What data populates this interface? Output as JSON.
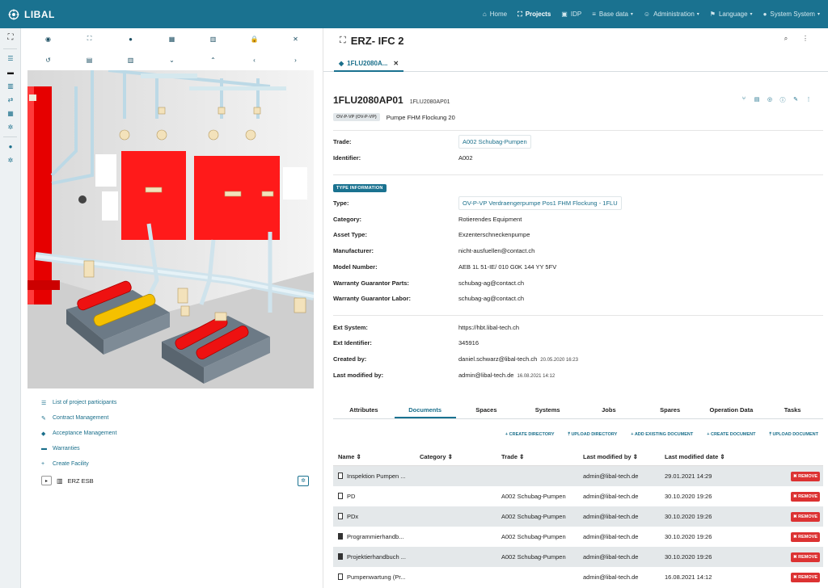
{
  "app": {
    "name": "LIBAL"
  },
  "nav": [
    {
      "icon": "home-icon",
      "glyph": "⌂",
      "label": "Home",
      "caret": false,
      "active": false
    },
    {
      "icon": "projects-icon",
      "glyph": "⛶",
      "label": "Projects",
      "caret": false,
      "active": true
    },
    {
      "icon": "idp-icon",
      "glyph": "▣",
      "label": "IDP",
      "caret": false,
      "active": false
    },
    {
      "icon": "database-icon",
      "glyph": "≡",
      "label": "Base data",
      "caret": true,
      "active": false
    },
    {
      "icon": "user-plus-icon",
      "glyph": "☺",
      "label": "Administration",
      "caret": true,
      "active": false
    },
    {
      "icon": "flag-icon",
      "glyph": "⚑",
      "label": "Language",
      "caret": true,
      "active": false
    },
    {
      "icon": "user-icon",
      "glyph": "●",
      "label": "System System",
      "caret": true,
      "active": false
    }
  ],
  "toolbar": {
    "row1": [
      {
        "icon": "eye-icon",
        "glyph": "◉"
      },
      {
        "icon": "expand-icon",
        "glyph": "⛶"
      },
      {
        "icon": "circle-icon",
        "glyph": "●"
      },
      {
        "icon": "grid-icon",
        "glyph": "▦"
      },
      {
        "icon": "building-icon",
        "glyph": "▥"
      },
      {
        "icon": "lock-icon",
        "glyph": "🔒"
      },
      {
        "icon": "close-icon",
        "glyph": "✕"
      }
    ],
    "row2": [
      {
        "icon": "undo-icon",
        "glyph": "↺"
      },
      {
        "icon": "floor-icon",
        "glyph": "▤"
      },
      {
        "icon": "structure-icon",
        "glyph": "▥"
      },
      {
        "icon": "chevron-down-icon",
        "glyph": "⌄"
      },
      {
        "icon": "chevron-up-icon",
        "glyph": "⌃"
      },
      {
        "icon": "chevron-left-icon",
        "glyph": "‹"
      },
      {
        "icon": "chevron-right-icon",
        "glyph": "›"
      }
    ]
  },
  "facility": {
    "links": [
      {
        "icon": "list-icon",
        "glyph": "☰",
        "label": "List of project participants"
      },
      {
        "icon": "contract-icon",
        "glyph": "✎",
        "label": "Contract Management"
      },
      {
        "icon": "tag-icon",
        "glyph": "◆",
        "label": "Acceptance Management"
      },
      {
        "icon": "truck-icon",
        "glyph": "▬",
        "label": "Warranties"
      },
      {
        "icon": "plus-icon",
        "glyph": "+",
        "label": "Create Facility"
      }
    ],
    "tree_item": "ERZ ESB"
  },
  "project": {
    "title": "ERZ- IFC 2"
  },
  "tab": {
    "label": "1FLU2080A..."
  },
  "asset": {
    "id": "1FLU2080AP01",
    "id_small": "1FLU2080AP01",
    "chip": "OV-P-VP (OV-P-VP)",
    "description": "Pumpe FHM Flockung 20"
  },
  "fields": {
    "trade": {
      "label": "Trade:",
      "value": "A002 Schubag-Pumpen"
    },
    "identifier": {
      "label": "Identifier:",
      "value": "A002"
    },
    "type_badge": "TYPE INFORMATION",
    "type": {
      "label": "Type:",
      "value": "OV-P-VP Verdraengerpumpe Pos1 FHM Flockung - 1FLU"
    },
    "category": {
      "label": "Category:",
      "value": "Rotierendes Equipment"
    },
    "asset_type": {
      "label": "Asset Type:",
      "value": "Exzenterschneckenpumpe"
    },
    "manufacturer": {
      "label": "Manufacturer:",
      "value": "nicht-ausfuellen@contact.ch"
    },
    "model": {
      "label": "Model Number:",
      "value": "AEB 1L 51-IE/ 010 G0K 144 YY 5FV"
    },
    "wg_parts": {
      "label": "Warranty Guarantor Parts:",
      "value": "schubag-ag@contact.ch"
    },
    "wg_labor": {
      "label": "Warranty Guarantor Labor:",
      "value": "schubag-ag@contact.ch"
    },
    "ext_system": {
      "label": "Ext System:",
      "value": "https://hbt.libal-tech.ch"
    },
    "ext_id": {
      "label": "Ext Identifier:",
      "value": "345916"
    },
    "created": {
      "label": "Created by:",
      "value": "daniel.schwarz@libal-tech.ch",
      "ts": "20.05.2020 16:23"
    },
    "modified": {
      "label": "Last modified by:",
      "value": "admin@libal-tech.de",
      "ts": "16.08.2021 14:12"
    }
  },
  "detail_tabs": [
    "Attributes",
    "Documents",
    "Spaces",
    "Systems",
    "Jobs",
    "Spares",
    "Operation Data",
    "Tasks"
  ],
  "doc_actions": [
    "+ CREATE DIRECTORY",
    "⤒ UPLOAD DIRECTORY",
    "+ ADD EXISTING DOCUMENT",
    "+ CREATE DOCUMENT",
    "⤒ UPLOAD DOCUMENT"
  ],
  "table": {
    "headers": [
      "Name ⇕",
      "Category ⇕",
      "Trade ⇕",
      "Last modified by ⇕",
      "Last modified date ⇕"
    ],
    "remove_label": "✖ REMOVE",
    "rows": [
      {
        "name": "Inspektion Pumpen ...",
        "category": "",
        "trade": "",
        "by": "admin@libal-tech.de",
        "date": "29.01.2021 14:29",
        "filled": false
      },
      {
        "name": "PD",
        "category": "",
        "trade": "A002 Schubag-Pumpen",
        "by": "admin@libal-tech.de",
        "date": "30.10.2020 19:26",
        "filled": false
      },
      {
        "name": "PDx",
        "category": "",
        "trade": "A002 Schubag-Pumpen",
        "by": "admin@libal-tech.de",
        "date": "30.10.2020 19:26",
        "filled": false
      },
      {
        "name": "Programmierhandb...",
        "category": "",
        "trade": "A002 Schubag-Pumpen",
        "by": "admin@libal-tech.de",
        "date": "30.10.2020 19:26",
        "filled": true
      },
      {
        "name": "Projektierhandbuch ...",
        "category": "",
        "trade": "A002 Schubag-Pumpen",
        "by": "admin@libal-tech.de",
        "date": "30.10.2020 19:26",
        "filled": true
      },
      {
        "name": "Pumpenwartung (Pr...",
        "category": "",
        "trade": "",
        "by": "admin@libal-tech.de",
        "date": "16.08.2021 14:12",
        "filled": false
      }
    ]
  },
  "colors": {
    "brand": "#1a7290",
    "remove": "#dc3232",
    "equipment_red": "#ff1a1a"
  }
}
